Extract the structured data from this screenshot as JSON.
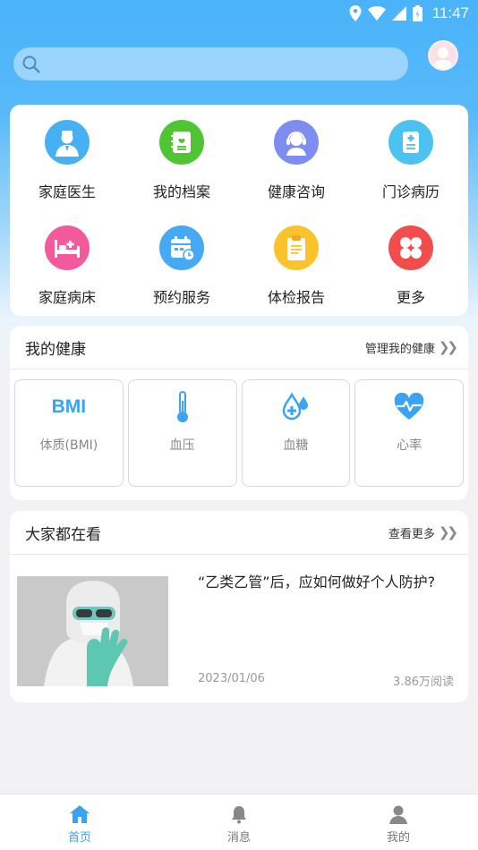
{
  "status_bar": {
    "time": "11:47"
  },
  "search": {
    "placeholder": ""
  },
  "menu": {
    "items": [
      {
        "label": "家庭医生",
        "icon": "doctor-icon",
        "color": "#45b1f2"
      },
      {
        "label": "我的档案",
        "icon": "archive-icon",
        "color": "#4fc533"
      },
      {
        "label": "健康咨询",
        "icon": "consult-icon",
        "color": "#7d8df0"
      },
      {
        "label": "门诊病历",
        "icon": "medical-record-icon",
        "color": "#4bc2ef"
      },
      {
        "label": "家庭病床",
        "icon": "home-bed-icon",
        "color": "#f25a9b"
      },
      {
        "label": "预约服务",
        "icon": "calendar-icon",
        "color": "#45a9f3"
      },
      {
        "label": "体检报告",
        "icon": "clipboard-icon",
        "color": "#fbc32b"
      },
      {
        "label": "更多",
        "icon": "more-icon",
        "color": "#f24c4c"
      }
    ]
  },
  "health": {
    "title": "我的健康",
    "manage_link": "管理我的健康",
    "bmi_text": "BMI",
    "tiles": [
      {
        "label": "体质(BMI)",
        "icon": "bmi-icon"
      },
      {
        "label": "血压",
        "icon": "thermometer-icon"
      },
      {
        "label": "血糖",
        "icon": "blood-drop-icon"
      },
      {
        "label": "心率",
        "icon": "heart-rate-icon"
      }
    ]
  },
  "news": {
    "title": "大家都在看",
    "more_link": "查看更多",
    "article": {
      "title": "“乙类乙管”后，应如何做好个人防护?",
      "date": "2023/01/06",
      "reads": "3.86万阅读"
    }
  },
  "tabs": [
    {
      "label": "首页",
      "icon": "home-icon",
      "active": true
    },
    {
      "label": "消息",
      "icon": "bell-icon",
      "active": false
    },
    {
      "label": "我的",
      "icon": "user-icon",
      "active": false
    }
  ],
  "colors": {
    "accent": "#3aa3f3",
    "header": "#4ab3fa"
  }
}
